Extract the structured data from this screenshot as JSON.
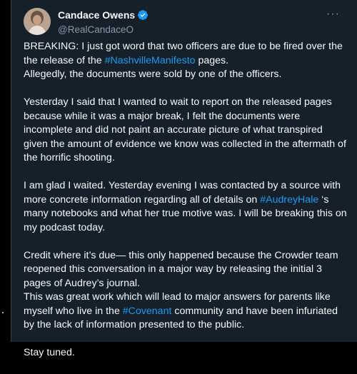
{
  "tweet": {
    "author": {
      "display_name": "Candace Owens",
      "handle": "@RealCandaceO",
      "verified_icon": "verified-badge-icon",
      "avatar_icon": "avatar-photo"
    },
    "more_icon": "more-options-icon",
    "more_label": "···",
    "paragraphs": [
      {
        "segments": [
          {
            "t": "BREAKING: I just got word that two officers are due to be fired over the the release of the "
          },
          {
            "t": "#NashvilleManifesto",
            "tag": true
          },
          {
            "t": " pages."
          }
        ],
        "gap": false
      },
      {
        "segments": [
          {
            "t": "Allegedly, the documents were sold by one of the officers."
          }
        ],
        "gap": true
      },
      {
        "segments": [
          {
            "t": "Yesterday I said that I wanted to wait to report on the released pages because while it was a major break, I felt the documents were incomplete and did not paint an accurate picture of what transpired given the amount of evidence we know was collected in the aftermath of the horrific shooting."
          }
        ],
        "gap": true
      },
      {
        "segments": [
          {
            "t": "I am glad I waited. Yesterday evening I was contacted by a source with more concrete information regarding all of details on "
          },
          {
            "t": "#AudreyHale",
            "tag": true
          },
          {
            "t": " ‘s many notebooks and what her true motive was. I will be breaking this on my podcast today."
          }
        ],
        "gap": true
      },
      {
        "segments": [
          {
            "t": "Credit where it’s due— this only happened because the Crowder team reopened this conversation in a major way by releasing the initial 3 pages of Audrey’s journal."
          }
        ],
        "gap": false
      },
      {
        "segments": [
          {
            "t": "This was great work which will lead to major answers for parents like myself who live in the "
          },
          {
            "t": "#Covenant",
            "tag": true
          },
          {
            "t": " community and have been infuriated by the lack of information presented to the public."
          }
        ],
        "gap": true
      },
      {
        "segments": [
          {
            "t": "Stay tuned."
          }
        ],
        "gap": true
      }
    ]
  },
  "colors": {
    "background": "#15202b",
    "text": "#f7f9f9",
    "secondary": "#8b98a5",
    "link": "#1d9bf0",
    "verified": "#1d9bf0"
  }
}
